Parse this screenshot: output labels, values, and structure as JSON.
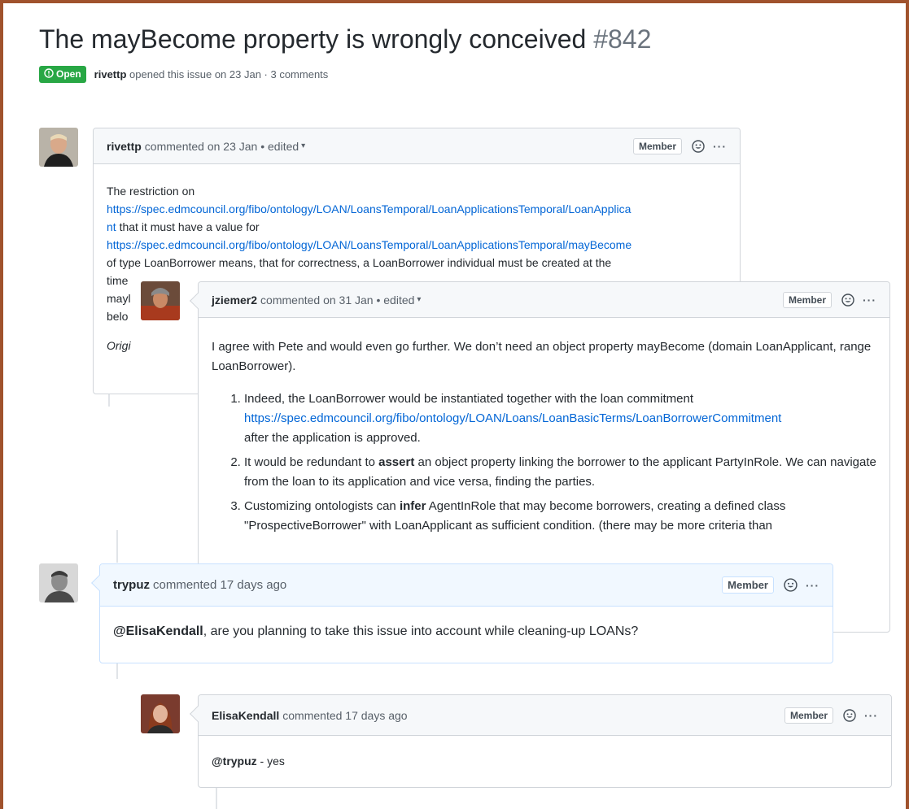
{
  "issue": {
    "title": "The mayBecome property is wrongly conceived",
    "number": "#842",
    "state": "Open",
    "author": "rivettp",
    "meta_text": "opened this issue on 23 Jan · 3 comments"
  },
  "comments": [
    {
      "author": "rivettp",
      "action": "commented on 23 Jan • edited",
      "role": "Member",
      "body": {
        "line1": "The restriction on",
        "link1": "https://spec.edmcouncil.org/fibo/ontology/LOAN/LoansTemporal/LoanApplicationsTemporal/LoanApplica",
        "link1_cont": "nt",
        "text2": " that it must have a value for",
        "link2": "https://spec.edmcouncil.org/fibo/ontology/LOAN/LoansTemporal/LoanApplicationsTemporal/mayBecome",
        "line3": "of type LoanBorrower means, that for correctness, a LoanBorrower individual must be created at the",
        "line4": "time",
        "line5": "mayl",
        "line6": "belo",
        "line7": "Origi"
      }
    },
    {
      "author": "jziemer2",
      "action": "commented on 31 Jan • edited",
      "role": "Member",
      "body": {
        "intro": "I agree with Pete and would even go further. We don’t need an object property mayBecome (domain LoanApplicant, range LoanBorrower).",
        "item1_text": "Indeed, the LoanBorrower would be instantiated together with the loan commitment",
        "item1_link": "https://spec.edmcouncil.org/fibo/ontology/LOAN/Loans/LoanBasicTerms/LoanBorrowerCommitment",
        "item1_after": "after the application is approved.",
        "item2_pre": "It would be redundant to ",
        "item2_strong": "assert",
        "item2_post": " an object property linking the borrower to the applicant PartyInRole. We can navigate from the loan to its application and vice versa, finding the parties.",
        "item3_pre": "Customizing ontologists can ",
        "item3_strong": "infer",
        "item3_post": " AgentInRole that may become borrowers, creating a defined class \"ProspectiveBorrower\" with LoanApplicant as sufficient condition. (there may be more criteria than"
      }
    },
    {
      "author": "trypuz",
      "action": "commented 17 days ago",
      "role": "Member",
      "body": {
        "mention": "@ElisaKendall",
        "text": ", are you planning to take this issue into account while cleaning-up LOANs?"
      }
    },
    {
      "author": "ElisaKendall",
      "action": "commented 17 days ago",
      "role": "Member",
      "body": {
        "mention": "@trypuz",
        "text": " - yes"
      }
    }
  ],
  "icons": {
    "reaction": "smiley-icon",
    "more": "kebab-icon",
    "state": "issue-opened-icon",
    "more_glyph": "···"
  },
  "colors": {
    "open_green": "#28a745",
    "link_blue": "#0366d6",
    "frame_brown": "#a0522d"
  }
}
